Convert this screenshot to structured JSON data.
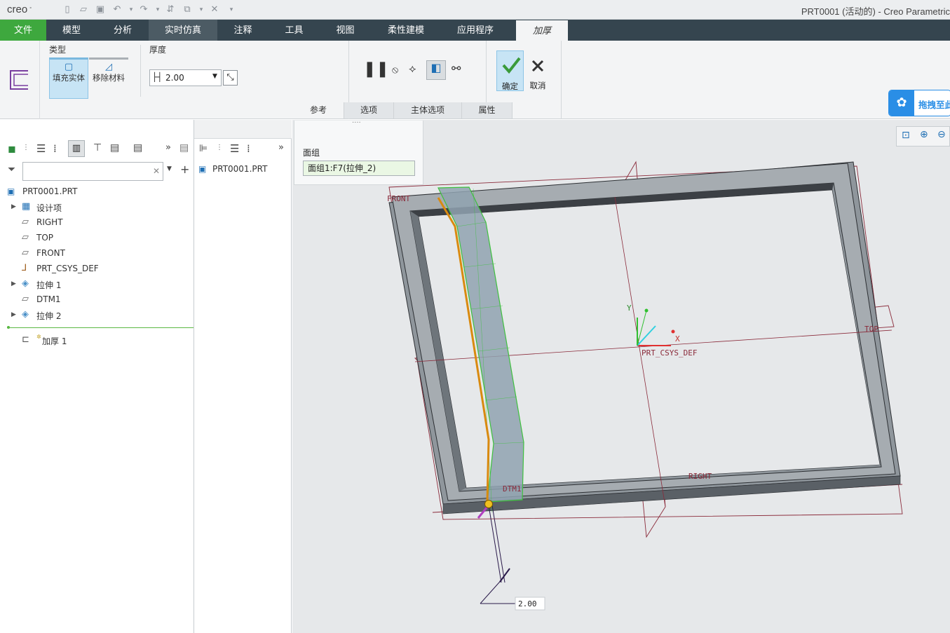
{
  "titlebar": {
    "logo": "creo",
    "window_title": "PRT0001 (活动的) - Creo Parametric"
  },
  "tabs": [
    "文件",
    "模型",
    "分析",
    "实时仿真",
    "注释",
    "工具",
    "视图",
    "柔性建模",
    "应用程序",
    "加厚"
  ],
  "ribbon": {
    "type_label": "类型",
    "fill_solid": "填充实体",
    "remove_material": "移除材料",
    "thickness_label": "厚度",
    "thickness_value": "2.00",
    "ok_label": "确定",
    "cancel_label": "取消",
    "dashboard_tabs": [
      "参考",
      "选项",
      "主体选项",
      "属性"
    ]
  },
  "baidu_button": "拖拽至此",
  "ref_panel": {
    "title": "面组",
    "value": "面组1:F7(拉伸_2)"
  },
  "model_tree": {
    "root": "PRT0001.PRT",
    "items": [
      "设计项",
      "RIGHT",
      "TOP",
      "FRONT",
      "PRT_CSYS_DEF",
      "拉伸 1",
      "DTM1",
      "拉伸 2"
    ],
    "new_feature": "加厚 1"
  },
  "layer_tree": {
    "item": "PRT0001.PRT"
  },
  "viewport": {
    "labels": {
      "front": "FRONT",
      "top": "TOP",
      "right": "RIGHT",
      "dtm1": "DTM1",
      "csys": "PRT_CSYS_DEF",
      "x": "X",
      "y": "Y",
      "dim": "2.00"
    }
  }
}
